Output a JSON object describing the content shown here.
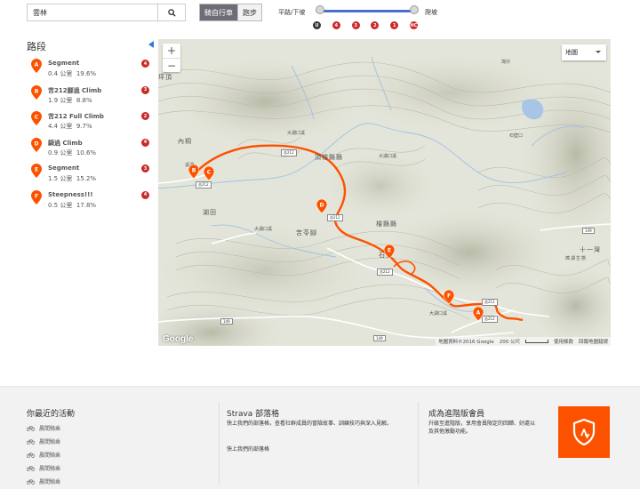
{
  "search": {
    "value": "雲林"
  },
  "mode": {
    "ride": "騎自行車",
    "run": "跑步"
  },
  "grade": {
    "flat_label": "平路/下坡",
    "climb_label": "爬坡",
    "min_level": 0,
    "max_level": 1,
    "categories": [
      "U",
      "4",
      "3",
      "2",
      "1",
      "HC"
    ]
  },
  "segments": {
    "title": "路段",
    "items": [
      {
        "letter": "A",
        "name": "Segment",
        "distance": "0.4 公里",
        "grade": "19.6%",
        "cat": "4"
      },
      {
        "letter": "B",
        "name": "苦212腳過 Climb",
        "distance": "1.9 公里",
        "grade": "8.8%",
        "cat": "3"
      },
      {
        "letter": "C",
        "name": "苦212 Full Climb",
        "distance": "4.4 公里",
        "grade": "9.7%",
        "cat": "2"
      },
      {
        "letter": "D",
        "name": "騎過 Climb",
        "distance": "0.9 公里",
        "grade": "10.6%",
        "cat": "4"
      },
      {
        "letter": "E",
        "name": "Segment",
        "distance": "1.5 公里",
        "grade": "15.2%",
        "cat": "3"
      },
      {
        "letter": "F",
        "name": "Steepness!!!",
        "distance": "0.5 公里",
        "grade": "17.8%",
        "cat": "4"
      }
    ]
  },
  "map": {
    "type_label": "地圖",
    "logo": "Google",
    "attribution": "地圖資料©2016 Google",
    "scale": "200 公尺",
    "terms": "使用條款",
    "report": "回報地圖錯誤",
    "places": {
      "p1": "頂檜縣縣",
      "p2": "苦苓腳",
      "p3": "石壁",
      "p4": "樟湖生態",
      "p5": "內桐",
      "p6": "湖田",
      "p7": "十一灣",
      "p8": "大湖口溪",
      "p9": "大湖口溪",
      "p10": "大湖口溪",
      "p11": "檜縣縣",
      "p12": "灣仔",
      "p13": "溪湖",
      "p14": "坪頂",
      "p15": "石壁口",
      "p16": "大湖口溪"
    },
    "routes": {
      "r1": "149",
      "r2": "149",
      "r3": "149",
      "r4": "苦212",
      "r5": "苦212",
      "r6": "苦212",
      "r7": "苦212",
      "r8": "苦212",
      "r9": "苦212"
    },
    "colors": {
      "route": "#fc5200",
      "pin": "#fc5200",
      "water": "#a8c5e8"
    }
  },
  "footer": {
    "recent_title": "你最近的活動",
    "activities": [
      "晨間騎乘",
      "晨間騎乘",
      "晨間騎乘",
      "晨間騎乘",
      "晨間騎乘"
    ],
    "clubs_title": "Strava 部落格",
    "clubs_text": "快上我們的部落格，查看社群成員的冒險故事、訓練技巧與深入見解。",
    "clubs_link": "快上我們的部落格",
    "premium_title": "成為進階版會員",
    "premium_text": "升級至進階版，享用會員限定的回饋、好處以及其他激勵功能。"
  }
}
